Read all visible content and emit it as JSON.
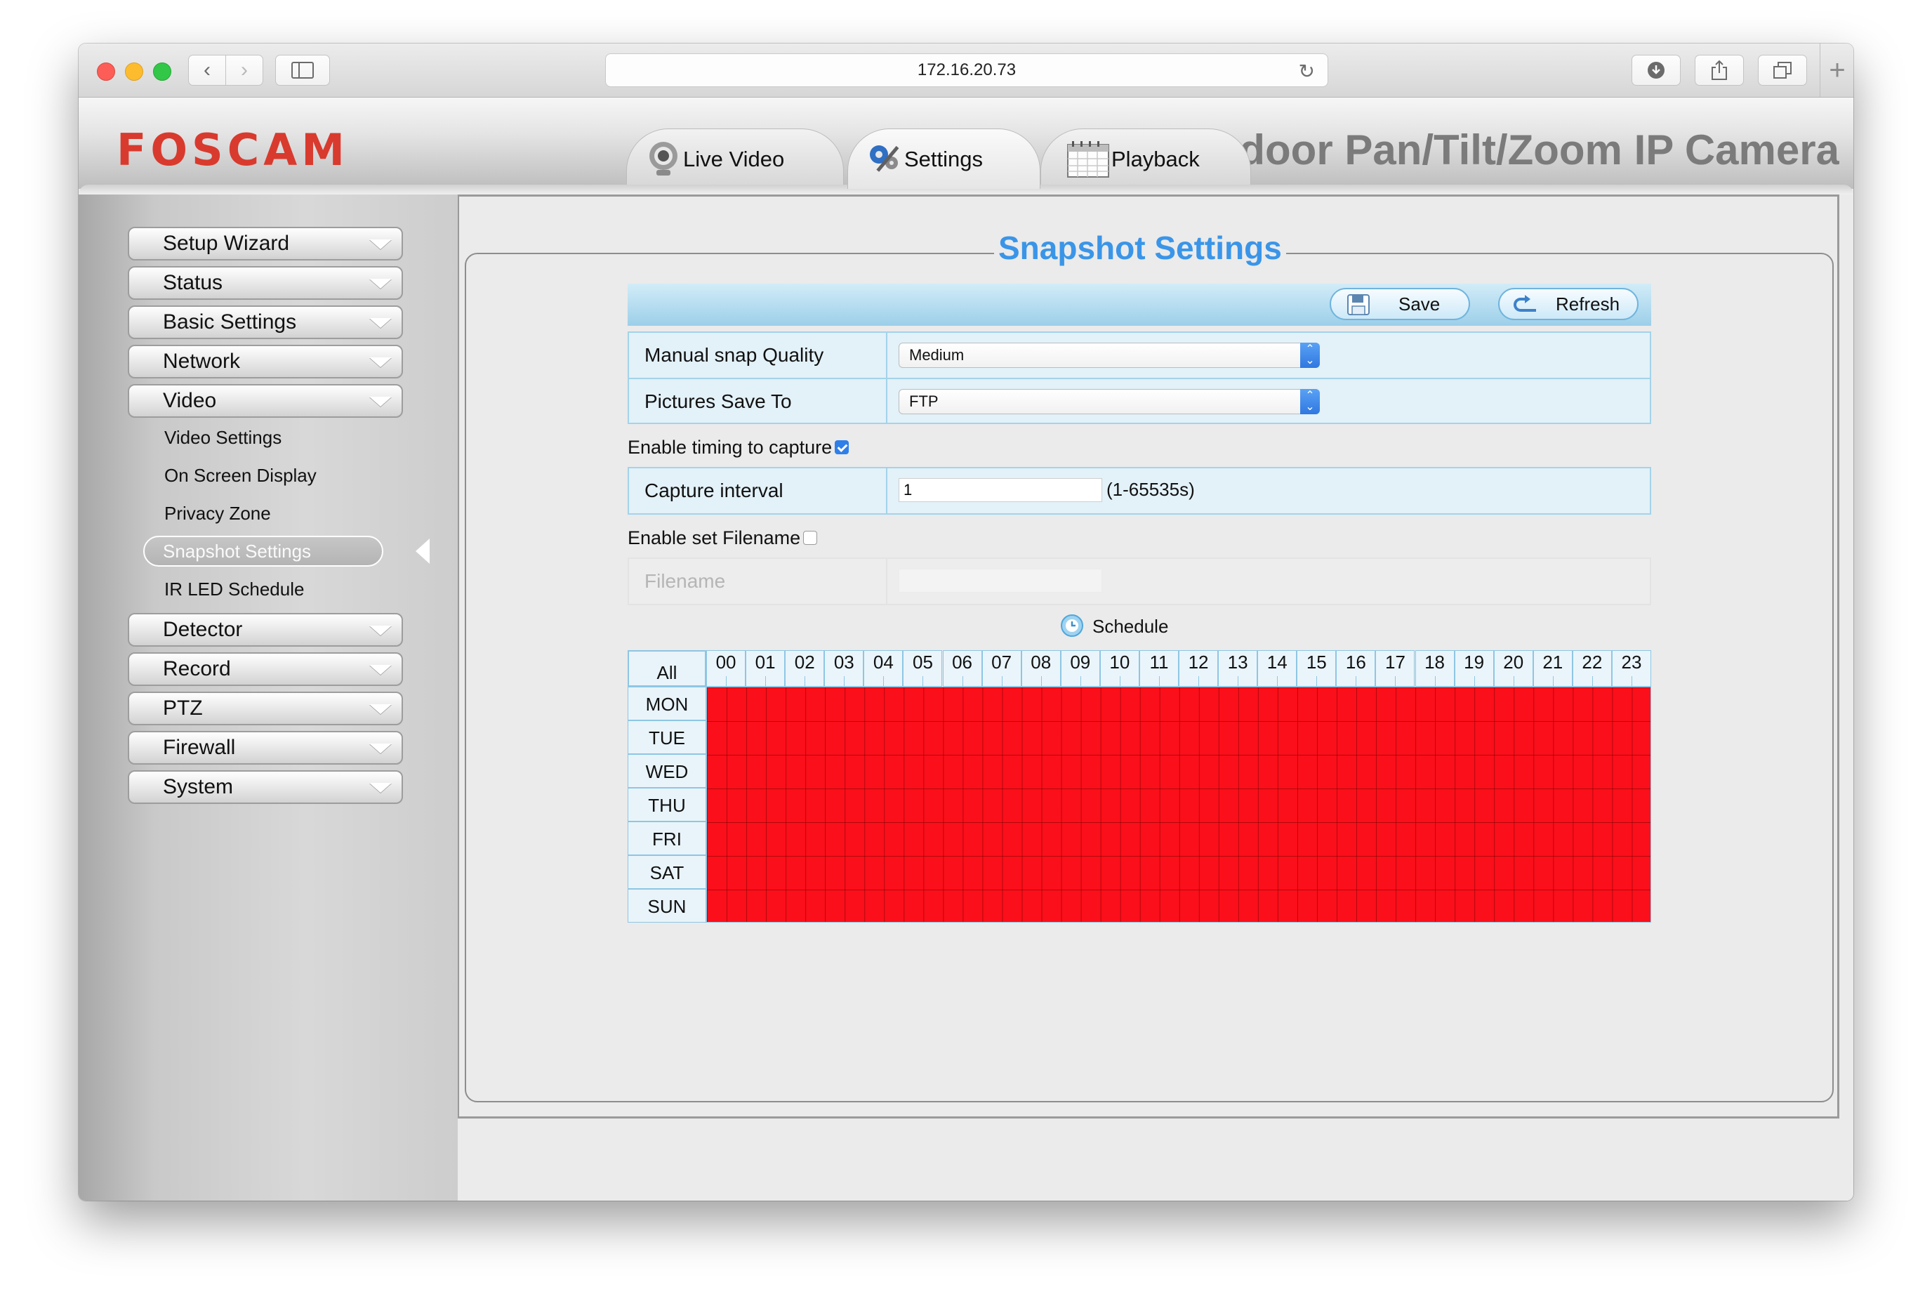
{
  "browser": {
    "url": "172.16.20.73",
    "back_icon": "chevron-left-icon",
    "forward_icon": "chevron-right-icon",
    "new_tab": "+"
  },
  "header": {
    "logo": "FOSCAM",
    "model_title": "Indoor Pan/Tilt/Zoom IP Camera",
    "tabs": [
      {
        "label": "Live Video",
        "icon": "webcam-icon"
      },
      {
        "label": "Settings",
        "icon": "gears-icon"
      },
      {
        "label": "Playback",
        "icon": "calendar-icon"
      }
    ]
  },
  "menu": {
    "items": [
      {
        "label": "Setup Wizard"
      },
      {
        "label": "Status"
      },
      {
        "label": "Basic Settings"
      },
      {
        "label": "Network"
      },
      {
        "label": "Video"
      }
    ],
    "video_sub": [
      {
        "label": "Video Settings"
      },
      {
        "label": "On Screen Display"
      },
      {
        "label": "Privacy Zone"
      },
      {
        "label": "Snapshot Settings"
      },
      {
        "label": "IR LED Schedule"
      }
    ],
    "items_after": [
      {
        "label": "Detector"
      },
      {
        "label": "Record"
      },
      {
        "label": "PTZ"
      },
      {
        "label": "Firewall"
      },
      {
        "label": "System"
      }
    ],
    "active": "Snapshot Settings"
  },
  "panel": {
    "title": "Snapshot Settings",
    "save_label": "Save",
    "refresh_label": "Refresh",
    "quality_label": "Manual snap Quality",
    "quality_value": "Medium",
    "save_to_label": "Pictures Save To",
    "save_to_value": "FTP",
    "timing_label": "Enable timing to capture",
    "timing_checked": true,
    "interval_label": "Capture interval",
    "interval_value": "1",
    "interval_hint": "(1-65535s)",
    "filename_enable_label": "Enable set Filename",
    "filename_checked": false,
    "filename_label": "Filename",
    "schedule_label": "Schedule"
  },
  "schedule": {
    "all_label": "All",
    "hours": [
      "00",
      "01",
      "02",
      "03",
      "04",
      "05",
      "06",
      "07",
      "08",
      "09",
      "10",
      "11",
      "12",
      "13",
      "14",
      "15",
      "16",
      "17",
      "18",
      "19",
      "20",
      "21",
      "22",
      "23"
    ],
    "days": [
      "MON",
      "TUE",
      "WED",
      "THU",
      "FRI",
      "SAT",
      "SUN"
    ],
    "selected_color": "#fb0f1a",
    "all_selected": true
  }
}
